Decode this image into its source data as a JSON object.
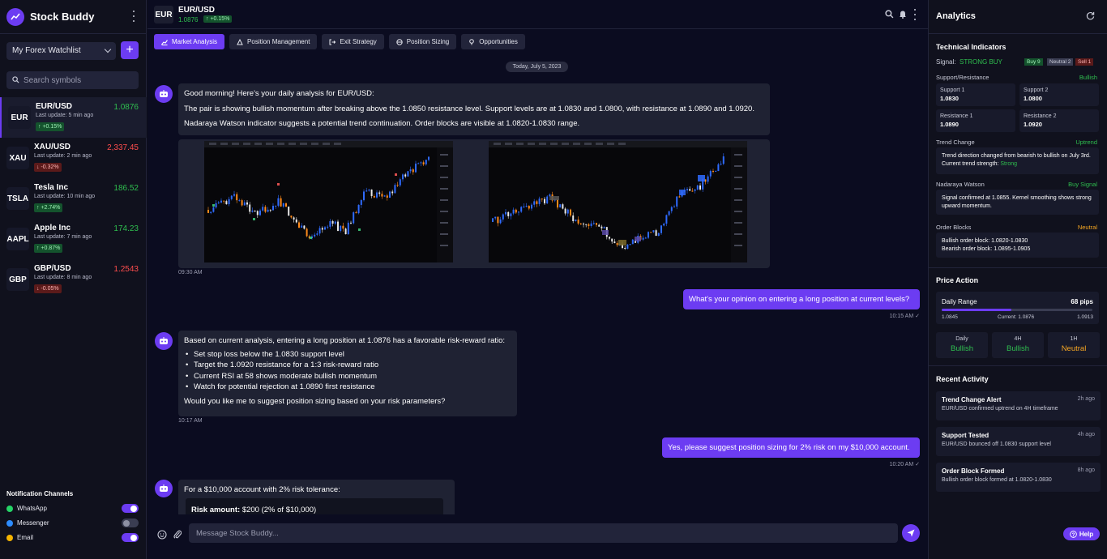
{
  "app": {
    "name": "Stock Buddy"
  },
  "watchlist": {
    "selected": "My Forex Watchlist",
    "search_placeholder": "Search symbols",
    "items": [
      {
        "symbol": "EUR",
        "name": "EUR/USD",
        "updated": "Last update: 5 min ago",
        "change": "↑ +0.15%",
        "price": "1.0876",
        "direction": "up",
        "active": true
      },
      {
        "symbol": "XAU",
        "name": "XAU/USD",
        "updated": "Last update: 2 min ago",
        "change": "↓ -0.32%",
        "price": "2,337.45",
        "direction": "down",
        "active": false
      },
      {
        "symbol": "TSLA",
        "name": "Tesla Inc",
        "updated": "Last update: 10 min ago",
        "change": "↑ +2.74%",
        "price": "186.52",
        "direction": "up",
        "active": false
      },
      {
        "symbol": "AAPL",
        "name": "Apple Inc",
        "updated": "Last update: 7 min ago",
        "change": "↑ +0.87%",
        "price": "174.23",
        "direction": "up",
        "active": false
      },
      {
        "symbol": "GBP",
        "name": "GBP/USD",
        "updated": "Last update: 8 min ago",
        "change": "↓ -0.05%",
        "price": "1.2543",
        "direction": "down",
        "active": false
      }
    ]
  },
  "notifications": {
    "title": "Notification Channels",
    "channels": [
      {
        "label": "WhatsApp",
        "icon": "whatsapp-icon",
        "color": "#25d366",
        "enabled": true
      },
      {
        "label": "Messenger",
        "icon": "messenger-icon",
        "color": "#2d8cff",
        "enabled": false
      },
      {
        "label": "Email",
        "icon": "email-icon",
        "color": "#f5b400",
        "enabled": true
      }
    ]
  },
  "header": {
    "tile": "EUR",
    "pair": "EUR/USD",
    "price": "1.0876",
    "change": "↑ +0.15%"
  },
  "tabs": [
    "Market Analysis",
    "Position Management",
    "Exit Strategy",
    "Position Sizing",
    "Opportunities"
  ],
  "chat": {
    "date": "Today, July 5, 2023",
    "m1": {
      "line1": "Good morning! Here's your daily analysis for EUR/USD:",
      "line2": "The pair is showing bullish momentum after breaking above the 1.0850 resistance level. Support levels are at 1.0830 and 1.0800, with resistance at 1.0890 and 1.0920.",
      "line3": "Nadaraya Watson indicator suggests a potential trend continuation. Order blocks are visible at 1.0820-1.0830 range.",
      "time": "09:30 AM"
    },
    "u1": {
      "text": "What's your opinion on entering a long position at current levels?",
      "time": "10:15 AM ✓"
    },
    "m2": {
      "intro": "Based on current analysis, entering a long position at 1.0876 has a favorable risk-reward ratio:",
      "bullets": [
        "Set stop loss below the 1.0830 support level",
        "Target the 1.0920 resistance for a 1:3 risk-reward ratio",
        "Current RSI at 58 shows moderate bullish momentum",
        "Watch for potential rejection at 1.0890 first resistance"
      ],
      "outro": "Would you like me to suggest position sizing based on your risk parameters?",
      "time": "10:17 AM"
    },
    "u2": {
      "text": "Yes, please suggest position sizing for 2% risk on my $10,000 account.",
      "time": "10:20 AM ✓"
    },
    "m3": {
      "intro": "For a $10,000 account with 2% risk tolerance:",
      "risk_label": "Risk amount:",
      "risk_value": " $200 (2% of $10,000)"
    },
    "composer_placeholder": "Message Stock Buddy..."
  },
  "analytics": {
    "title": "Analytics",
    "tech_title": "Technical Indicators",
    "signal_label": "Signal:",
    "signal_value": "STRONG BUY",
    "chips": {
      "buy": "Buy 9",
      "neutral": "Neutral 2",
      "sell": "Sell 1"
    },
    "sr_label": "Support/Resistance",
    "sr_status": "Bullish",
    "levels": [
      {
        "label": "Support 1",
        "value": "1.0830"
      },
      {
        "label": "Support 2",
        "value": "1.0800"
      },
      {
        "label": "Resistance 1",
        "value": "1.0890"
      },
      {
        "label": "Resistance 2",
        "value": "1.0920"
      }
    ],
    "trend_label": "Trend Change",
    "trend_status": "Uptrend",
    "trend_text": "Trend direction changed from bearish to bullish on July 3rd. Current trend strength:",
    "trend_strength": "Strong",
    "nw_label": "Nadaraya Watson",
    "nw_status": "Buy Signal",
    "nw_text": "Signal confirmed at 1.0855. Kernel smoothing shows strong upward momentum.",
    "ob_label": "Order Blocks",
    "ob_status": "Neutral",
    "ob_line1": "Bullish order block: 1.0820-1.0830",
    "ob_line2": "Bearish order block: 1.0895-1.0905",
    "pa_title": "Price Action",
    "range_label": "Daily Range",
    "range_value": "68 pips",
    "range_low": "1.0845",
    "range_current": "Current: 1.0876",
    "range_high": "1.0913",
    "range_fill": 0.46,
    "timeframes": [
      {
        "tf": "Daily",
        "status": "Bullish",
        "color": "#2fbf4f"
      },
      {
        "tf": "4H",
        "status": "Bullish",
        "color": "#2fbf4f"
      },
      {
        "tf": "1H",
        "status": "Neutral",
        "color": "#f5a623"
      }
    ],
    "activity_title": "Recent Activity",
    "activity": [
      {
        "title": "Trend Change Alert",
        "text": "EUR/USD confirmed uptrend on 4H timeframe",
        "time": "2h ago"
      },
      {
        "title": "Support Tested",
        "text": "EUR/USD bounced off 1.0830 support level",
        "time": "4h ago"
      },
      {
        "title": "Order Block Formed",
        "text": "Bullish order block formed at 1.0820-1.0830",
        "time": "8h ago"
      }
    ],
    "help": "Help"
  }
}
